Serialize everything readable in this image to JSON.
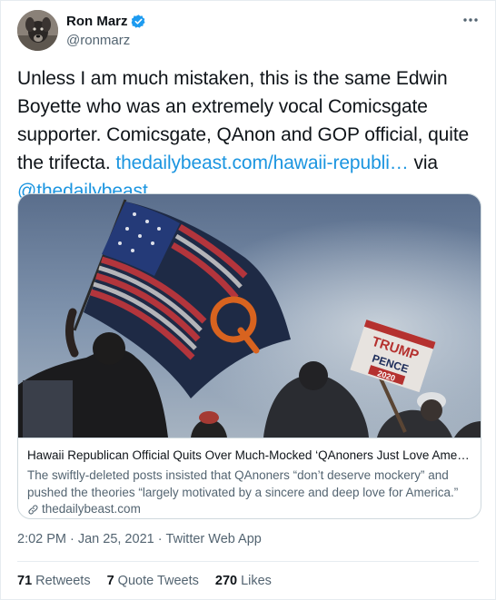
{
  "author": {
    "display_name": "Ron Marz",
    "handle": "@ronmarz",
    "verified": true
  },
  "tweet": {
    "text_main": "Unless I am much mistaken, this is the same Edwin Boyette who was an extremely vocal Comicsgate supporter. Comicsgate, QAnon and GOP official, quite the trifecta. ",
    "link_text": "thedailybeast.com/hawaii-republi…",
    "text_via": " via ",
    "mention": "@thedailybeast"
  },
  "card": {
    "title": "Hawaii Republican Official Quits Over Much-Mocked ‘QAnoners Just Love Ameri…",
    "description": "The swiftly-deleted posts insisted that QAnoners “don’t deserve mockery” and pushed the theories “largely motivated by a sincere and deep love for America.”",
    "domain": "thedailybeast.com",
    "image_sign": {
      "line1": "TRUMP",
      "line2": "PENCE",
      "line3": "2020"
    }
  },
  "meta": {
    "time": "2:02 PM",
    "separator": "·",
    "date": "Jan 25, 2021",
    "app": "Twitter Web App"
  },
  "stats": {
    "retweets_count": "71",
    "retweets_label": "Retweets",
    "quotes_count": "7",
    "quotes_label": "Quote Tweets",
    "likes_count": "270",
    "likes_label": "Likes"
  },
  "colors": {
    "link": "#1b95e0",
    "verified": "#1d9bf0",
    "secondary_text": "#536471"
  },
  "icons": [
    "verified-badge-icon",
    "more-dots-icon",
    "link-icon"
  ]
}
